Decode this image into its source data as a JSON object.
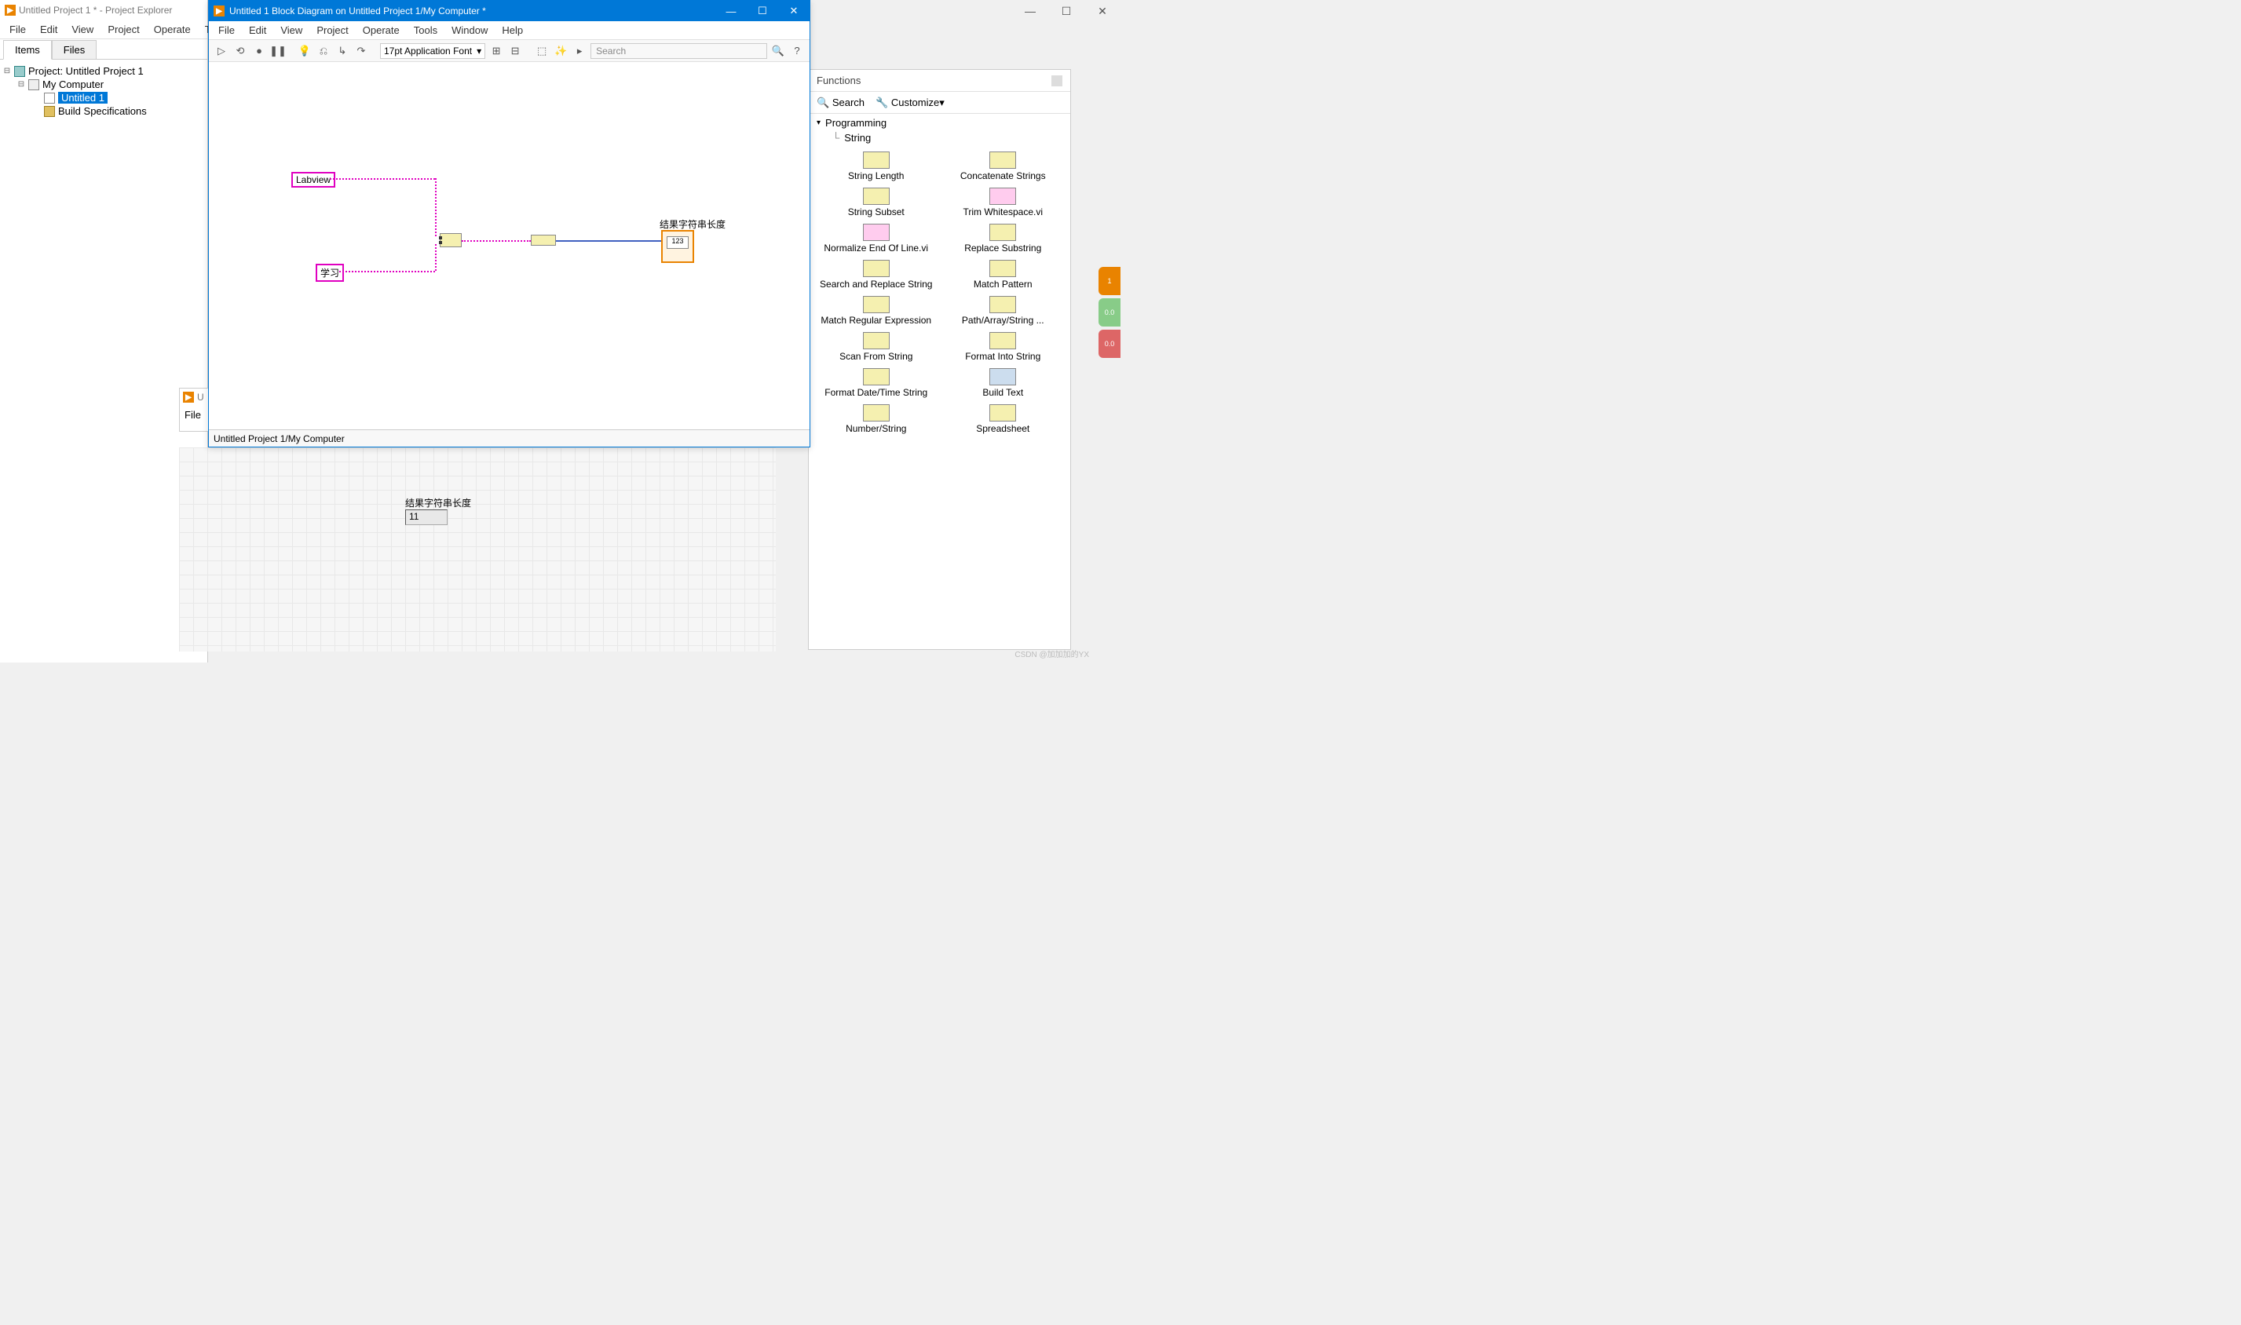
{
  "outer_window": {
    "min": "—",
    "max": "☐",
    "close": "✕"
  },
  "project_explorer": {
    "title": "Untitled Project 1 * - Project Explorer",
    "menus": [
      "File",
      "Edit",
      "View",
      "Project",
      "Operate",
      "Tools"
    ],
    "tabs": {
      "items": "Items",
      "files": "Files"
    },
    "tree": {
      "root": "Project: Untitled Project 1",
      "computer": "My Computer",
      "vi": "Untitled 1",
      "build": "Build Specifications"
    }
  },
  "block_diagram": {
    "title": "Untitled 1 Block Diagram on Untitled Project 1/My Computer *",
    "menus": [
      "File",
      "Edit",
      "View",
      "Project",
      "Operate",
      "Tools",
      "Window",
      "Help"
    ],
    "font_combo": "17pt Application Font",
    "search_placeholder": "Search",
    "status": "Untitled Project 1/My Computer",
    "nodes": {
      "const1": "Labview",
      "const2": "学习",
      "indicator_label": "结果字符串长度",
      "indicator_val_hint": "123"
    }
  },
  "front_panel_stub": {
    "title_prefix": "U",
    "menu": "File"
  },
  "front_panel": {
    "control_label": "结果字符串长度",
    "control_value": "11"
  },
  "functions_palette": {
    "header": "Functions",
    "search": "Search",
    "customize": "Customize",
    "crumb_parent": "Programming",
    "crumb_child": "String",
    "items": [
      "String Length",
      "Concatenate Strings",
      "String Subset",
      "Trim Whitespace.vi",
      "Normalize End Of Line.vi",
      "Replace Substring",
      "Search and Replace String",
      "Match Pattern",
      "Match Regular Expression",
      "Path/Array/String ...",
      "Scan From String",
      "Format Into String",
      "Format Date/Time String",
      "Build Text",
      "Number/String",
      "Spreadsheet"
    ]
  },
  "side_tabs": {
    "t1": "1",
    "t2": "0.0",
    "t3": "0.0"
  },
  "watermark": "CSDN @加加加的YX"
}
